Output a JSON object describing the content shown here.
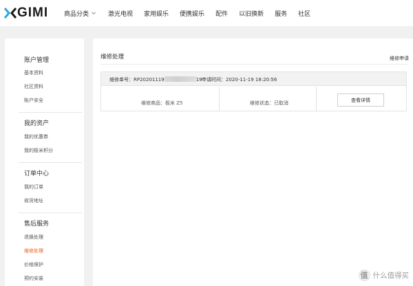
{
  "brand": {
    "logo_text": "GIMI",
    "accent_color": "#e2621b"
  },
  "nav": {
    "items": [
      {
        "label": "商品分类",
        "has_dropdown": true
      },
      {
        "label": "激光电视"
      },
      {
        "label": "家用娱乐"
      },
      {
        "label": "便携娱乐"
      },
      {
        "label": "配件"
      },
      {
        "label": "以旧换新"
      },
      {
        "label": "服务"
      },
      {
        "label": "社区"
      }
    ]
  },
  "sidebar": {
    "groups": [
      {
        "title": "账户管理",
        "items": [
          {
            "label": "基本资料"
          },
          {
            "label": "社区资料"
          },
          {
            "label": "账户安全"
          }
        ]
      },
      {
        "title": "我的资产",
        "items": [
          {
            "label": "我的优惠券"
          },
          {
            "label": "我的极米积分"
          }
        ]
      },
      {
        "title": "订单中心",
        "items": [
          {
            "label": "我的订单"
          },
          {
            "label": "收货地址"
          }
        ]
      },
      {
        "title": "售后服务",
        "items": [
          {
            "label": "退换处理"
          },
          {
            "label": "维修处理",
            "active": true
          },
          {
            "label": "价格保护"
          },
          {
            "label": "预约安装"
          }
        ]
      }
    ]
  },
  "main": {
    "title": "维修处理",
    "apply_link": "维修申请",
    "record": {
      "order_no_label": "维修单号：",
      "order_no_prefix": "RP20201119",
      "order_no_suffix": "19",
      "apply_time_label": "申请时间：",
      "apply_time": "2020-11-19 18:20:56",
      "product_label": "维修商品：",
      "product": "极米 Z5",
      "status_label": "维修状态：",
      "status": "已取消",
      "detail_button": "查看详情"
    }
  },
  "watermark": {
    "badge": "值",
    "text": "什么值得买"
  }
}
